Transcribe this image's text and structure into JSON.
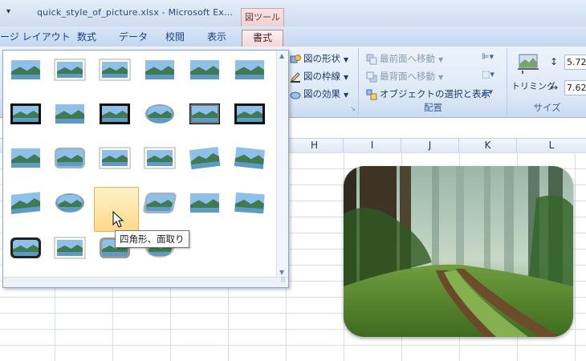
{
  "window": {
    "qat_arrow": "▾",
    "title": "quick_style_of_picture.xlsx - Microsoft Ex...",
    "context_tab_group": "図ツール"
  },
  "tabs": [
    {
      "label": "ージ レイアウト"
    },
    {
      "label": "数式"
    },
    {
      "label": "データ"
    },
    {
      "label": "校閲"
    },
    {
      "label": "表示"
    },
    {
      "label": "書式",
      "active": true
    }
  ],
  "ribbon": {
    "picture_styles": {
      "shape": "図の形状",
      "border": "図の枠線",
      "effects": "図の効果"
    },
    "arrange": {
      "bring_front": "最前面へ移動",
      "send_back": "最背面へ移動",
      "selection_pane": "オブジェクトの選択と表示",
      "label": "配置"
    },
    "size": {
      "crop": "トリミング",
      "height": "5.72",
      "width": "7.62",
      "label": "サイズ"
    }
  },
  "columns": [
    "H",
    "I",
    "J",
    "K",
    "L"
  ],
  "gallery": {
    "tooltip": "四角形、面取り",
    "rows": 5,
    "cols": 6
  },
  "colors": {
    "accent_tab": "#f3d6d6",
    "hover": "#ffd98a",
    "ribbon": "#dde8f6"
  }
}
